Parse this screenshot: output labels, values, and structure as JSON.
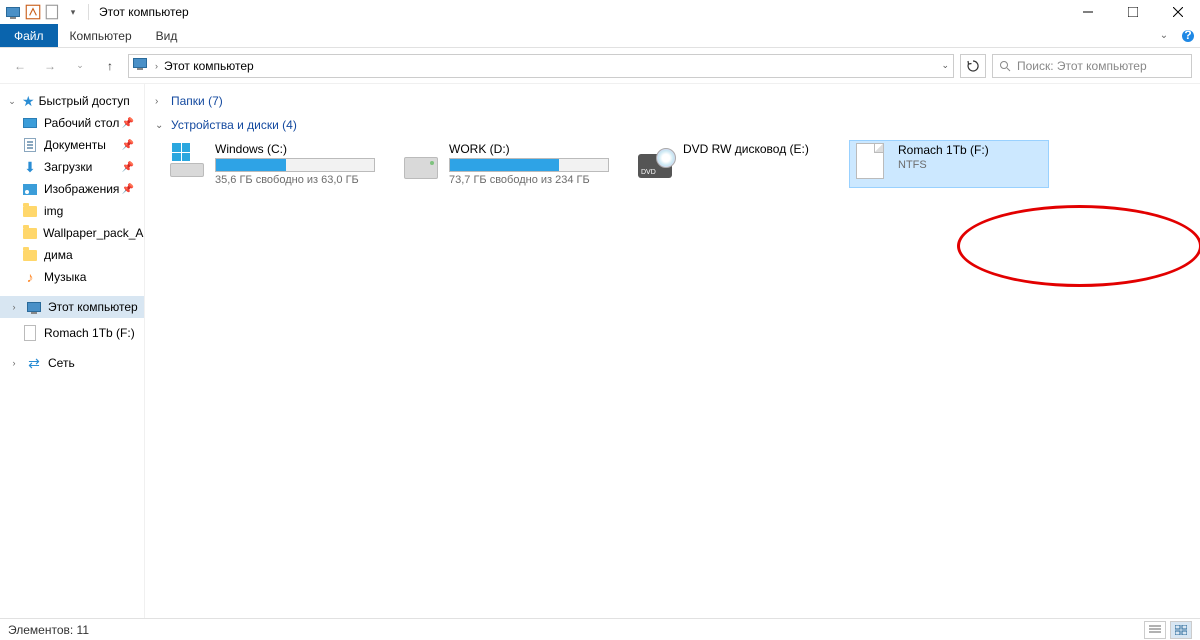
{
  "titlebar": {
    "title": "Этот компьютер"
  },
  "ribbon": {
    "file": "Файл",
    "tabs": [
      "Компьютер",
      "Вид"
    ]
  },
  "address": {
    "location": "Этот компьютер"
  },
  "search": {
    "placeholder": "Поиск: Этот компьютер"
  },
  "nav": {
    "quick_access": "Быстрый доступ",
    "items": [
      {
        "label": "Рабочий стол",
        "pinned": true,
        "icon": "desktop"
      },
      {
        "label": "Документы",
        "pinned": true,
        "icon": "docs"
      },
      {
        "label": "Загрузки",
        "pinned": true,
        "icon": "download"
      },
      {
        "label": "Изображения",
        "pinned": true,
        "icon": "image"
      },
      {
        "label": "img",
        "pinned": false,
        "icon": "folder"
      },
      {
        "label": "Wallpaper_pack_An",
        "pinned": false,
        "icon": "folder"
      },
      {
        "label": "дима",
        "pinned": false,
        "icon": "folder"
      },
      {
        "label": "Музыка",
        "pinned": false,
        "icon": "music"
      }
    ],
    "this_pc": "Этот компьютер",
    "romach": "Romach 1Tb (F:)",
    "network": "Сеть"
  },
  "sections": {
    "folders": {
      "label": "Папки",
      "count": 7
    },
    "devices": {
      "label": "Устройства и диски",
      "count": 4
    }
  },
  "drives": [
    {
      "name": "Windows (C:)",
      "free": "35,6 ГБ свободно из 63,0 ГБ",
      "fill_pct": 44,
      "icon": "os"
    },
    {
      "name": "WORK (D:)",
      "free": "73,7 ГБ свободно из 234 ГБ",
      "fill_pct": 69,
      "icon": "hdd"
    },
    {
      "name": "DVD RW дисковод (E:)",
      "icon": "dvd"
    },
    {
      "name": "Romach 1Tb (F:)",
      "sub": "NTFS",
      "icon": "file",
      "selected": true
    }
  ],
  "status": {
    "text": "Элементов: 11"
  }
}
